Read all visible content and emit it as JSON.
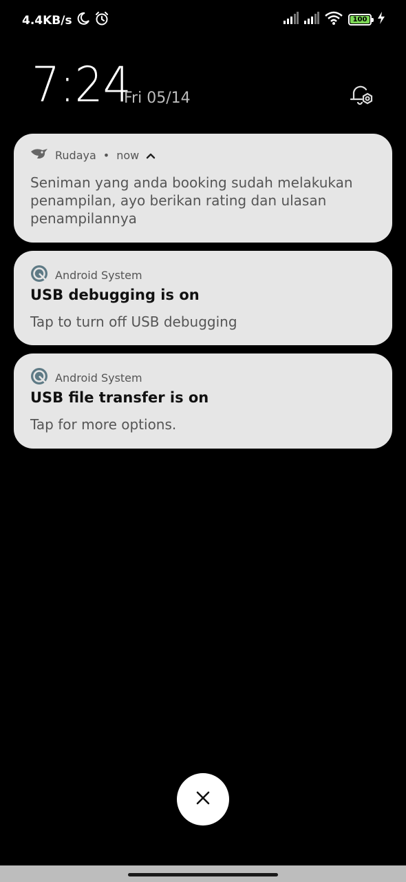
{
  "status_bar": {
    "net_speed": "4.4KB/s",
    "battery_level": "100",
    "icons": [
      "moon-icon",
      "alarm-icon",
      "signal-icon",
      "signal-icon",
      "wifi-icon",
      "battery-icon",
      "charging-bolt-icon"
    ]
  },
  "clock": {
    "time": "7:24",
    "date": "Fri 05/14"
  },
  "notifications": [
    {
      "app": "Rudaya",
      "time": "now",
      "icon": "rudaya-bird-icon",
      "body": "Seniman yang anda booking sudah melakukan penampilan, ayo berikan rating dan ulasan penampilannya"
    },
    {
      "app": "Android System",
      "icon": "android-system-icon",
      "title": "USB debugging is on",
      "body": "Tap to turn off USB debugging"
    },
    {
      "app": "Android System",
      "icon": "android-system-icon",
      "title": "USB file transfer is on",
      "body": "Tap for more options."
    }
  ],
  "colors": {
    "background": "#000000",
    "card": "#e6e6e6",
    "battery_fill": "#7ed957"
  }
}
